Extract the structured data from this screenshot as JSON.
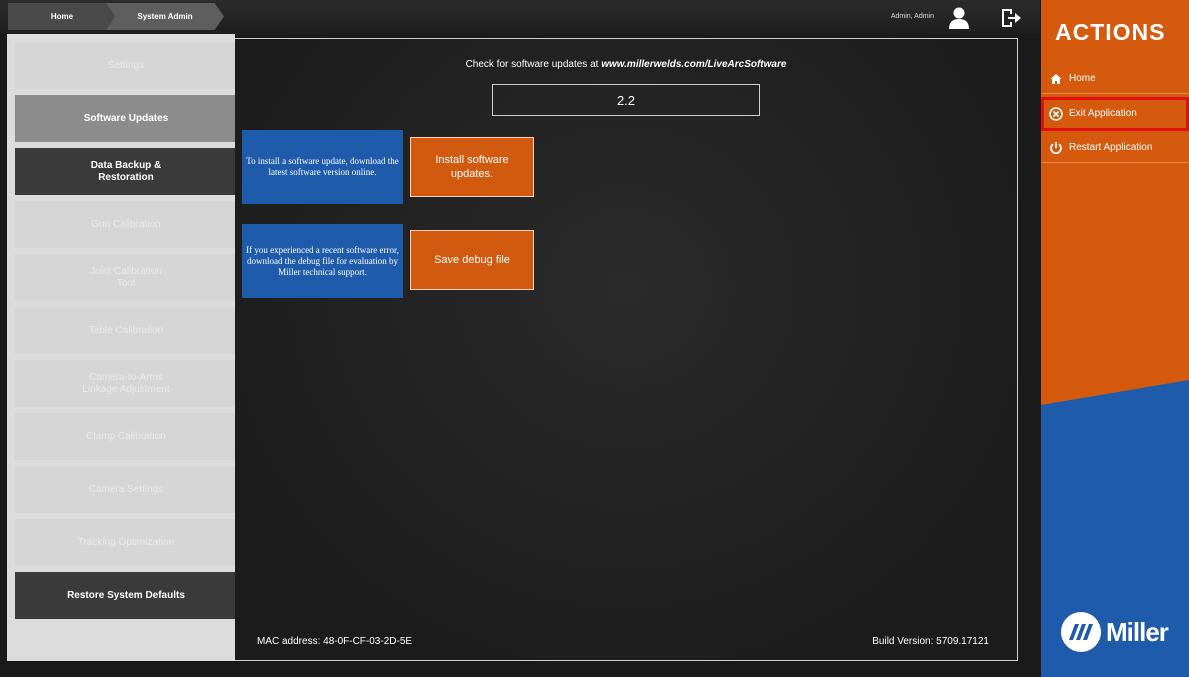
{
  "topbar": {
    "breadcrumbs": [
      "Home",
      "System Admin"
    ],
    "user_name": "Admin, Admin"
  },
  "sidebar": {
    "items": [
      {
        "label": "Settings",
        "state": "disabled"
      },
      {
        "label": "Software Updates",
        "state": "selected"
      },
      {
        "label": "Data Backup &\nRestoration",
        "state": "active"
      },
      {
        "label": "Gun Calibration",
        "state": "disabled"
      },
      {
        "label": "Joint Calibration\nTool",
        "state": "disabled"
      },
      {
        "label": "Table Calibration",
        "state": "disabled"
      },
      {
        "label": "Camera-to-Arms\nLinkage Adjustment",
        "state": "disabled"
      },
      {
        "label": "Clamp Calibration",
        "state": "disabled"
      },
      {
        "label": "Camera Settings",
        "state": "disabled"
      },
      {
        "label": "Tracking Optimization",
        "state": "disabled"
      },
      {
        "label": "Restore System Defaults",
        "state": "active"
      }
    ]
  },
  "main": {
    "update_heading_prefix": "Check for software updates at ",
    "update_heading_url": "www.millerwelds.com/LiveArcSoftware",
    "version": "2.2",
    "install_info": "To install a software update, download the latest software version online.",
    "install_button": "Install software updates.",
    "debug_info": "If you experienced a recent software error, download the debug file for evaluation by Miller technical support.",
    "debug_button": "Save debug file",
    "mac_address": "MAC address: 48-0F-CF-03-2D-5E",
    "build_version": "Build Version: 5709.17121"
  },
  "actions": {
    "title": "ACTIONS",
    "items": [
      {
        "label": "Home",
        "icon": "home-icon"
      },
      {
        "label": "Exit Application",
        "icon": "close-circle-icon"
      },
      {
        "label": "Restart Application",
        "icon": "power-icon"
      }
    ],
    "logo_text": "Miller"
  },
  "colors": {
    "orange": "#d55a0e",
    "blue": "#1e5cab",
    "highlight": "#e01010"
  }
}
